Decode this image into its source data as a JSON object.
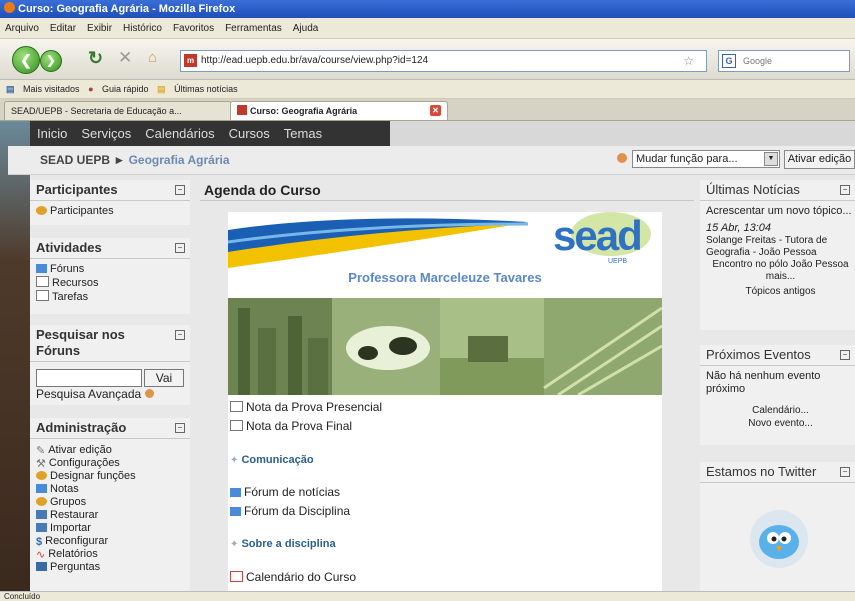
{
  "window": {
    "title": "Curso: Geografia Agrária - Mozilla Firefox"
  },
  "menu": [
    "Arquivo",
    "Editar",
    "Exibir",
    "Histórico",
    "Favoritos",
    "Ferramentas",
    "Ajuda"
  ],
  "url": "http://ead.uepb.edu.br/ava/course/view.php?id=124",
  "search_placeholder": "Google",
  "bookmarks": [
    "Mais visitados",
    "Guia rápido",
    "Últimas notícias"
  ],
  "tabs": [
    {
      "label": "SEAD/UEPB - Secretaria de Educação a..."
    },
    {
      "label": "Curso: Geografia Agrária"
    }
  ],
  "topnav": [
    "Inicio",
    "Serviços",
    "Calendários",
    "Cursos",
    "Temas"
  ],
  "breadcrumb": {
    "home": "SEAD UEPB",
    "sep": "►",
    "course": "Geografia Agrária"
  },
  "role_select": "Mudar função para...",
  "edit_button": "Ativar edição",
  "left": {
    "participantes": {
      "title": "Participantes",
      "items": [
        "Participantes"
      ]
    },
    "atividades": {
      "title": "Atividades",
      "items": [
        "Fóruns",
        "Recursos",
        "Tarefas"
      ]
    },
    "pesquisar": {
      "title": "Pesquisar nos Fóruns",
      "go": "Vai",
      "advanced": "Pesquisa Avançada"
    },
    "admin": {
      "title": "Administração",
      "items": [
        "Ativar edição",
        "Configurações",
        "Designar funções",
        "Notas",
        "Grupos",
        "Restaurar",
        "Importar",
        "Reconfigurar",
        "Relatórios",
        "Perguntas"
      ]
    }
  },
  "center": {
    "title": "Agenda do Curso",
    "logo": "sead",
    "logo_sub": "UEPB",
    "professor": "Professora Marceleuze Tavares",
    "links1": [
      "Nota da Prova Presencial",
      "Nota da Prova Final"
    ],
    "section1": "Comunicação",
    "links2": [
      "Fórum de notícias",
      "Fórum da Disciplina"
    ],
    "section2": "Sobre a disciplina",
    "links3": [
      "Calendário do Curso"
    ]
  },
  "right": {
    "news": {
      "title": "Últimas Notícias",
      "add": "Acrescentar um novo tópico...",
      "date": "15 Abr, 13:04",
      "author": "Solange Freitas - Tutora de Geografia - João Pessoa",
      "text": "Encontro no pólo João Pessoa mais...",
      "older": "Tópicos antigos"
    },
    "events": {
      "title": "Próximos Eventos",
      "none": "Não há nenhum evento próximo",
      "calendar": "Calendário...",
      "new": "Novo evento..."
    },
    "twitter": {
      "title": "Estamos no Twitter"
    }
  },
  "status": "Concluído"
}
